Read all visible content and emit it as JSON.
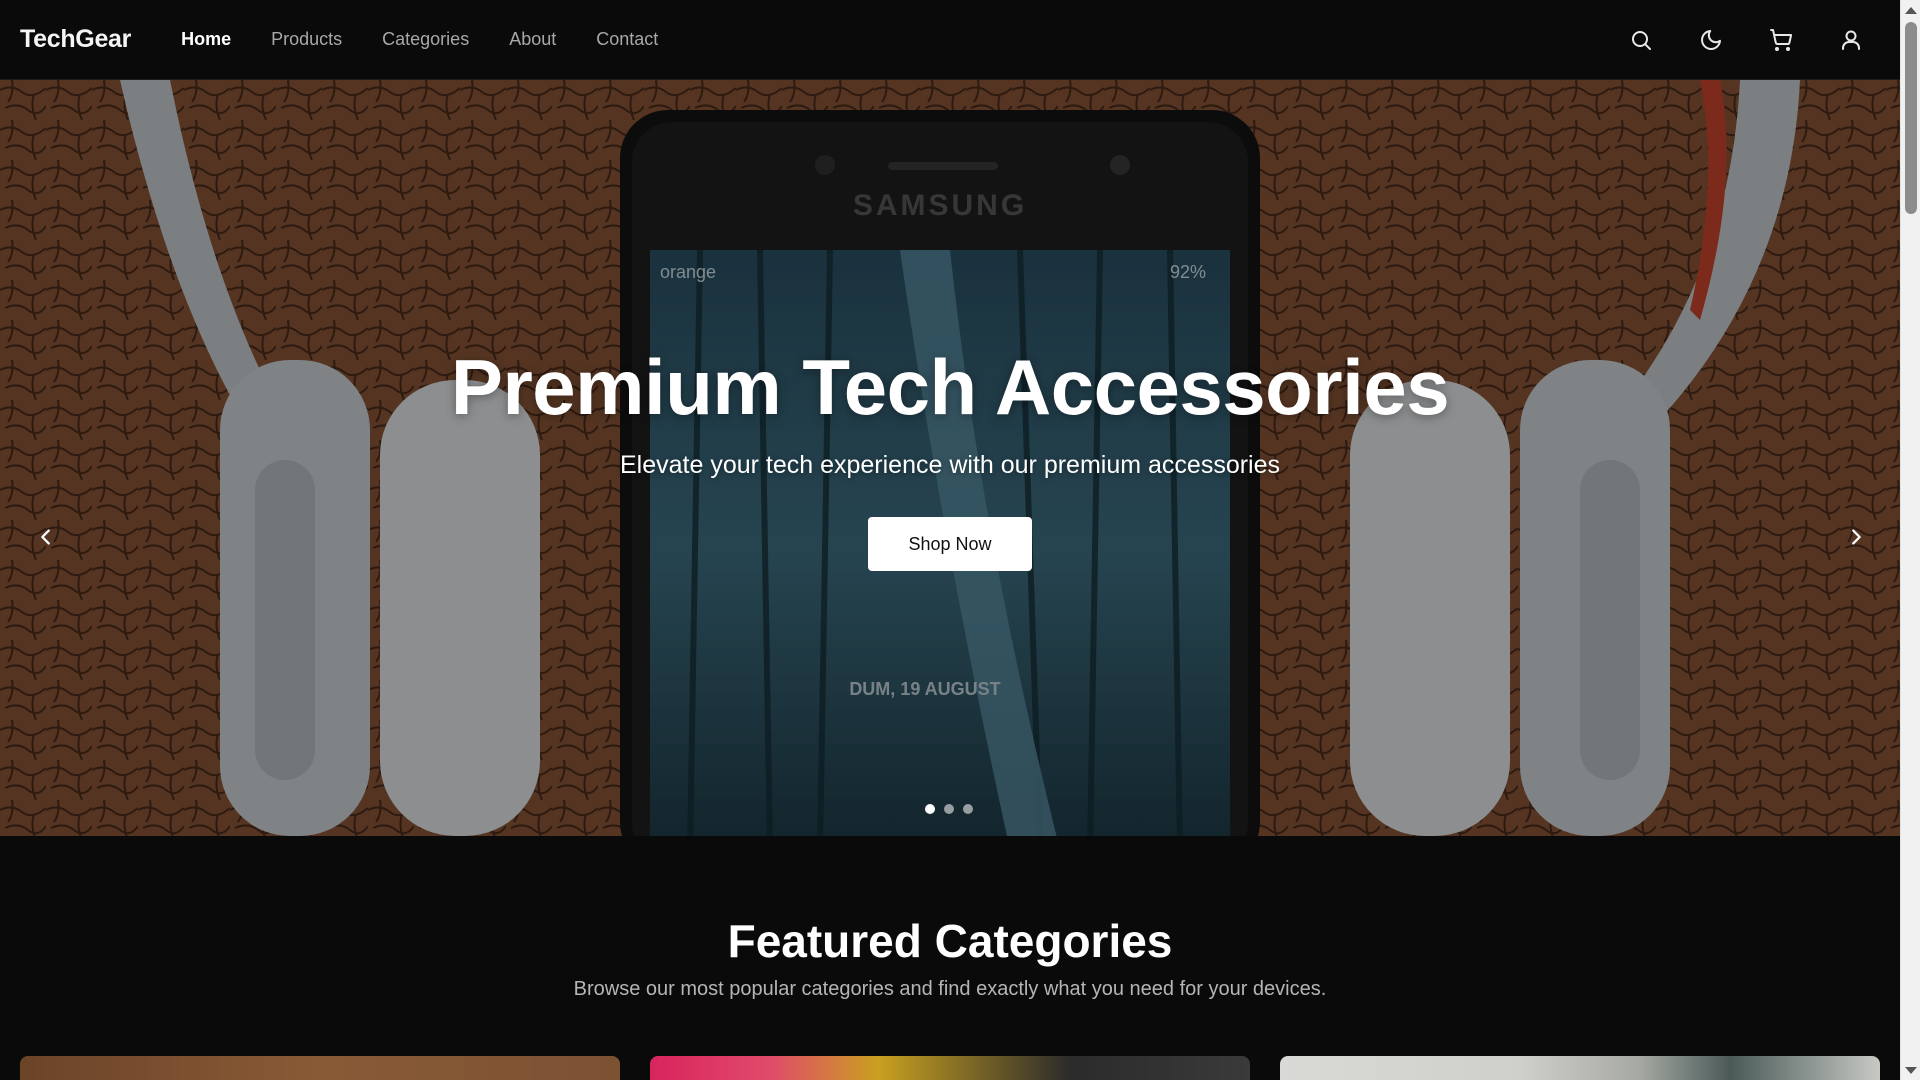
{
  "header": {
    "logo": "TechGear",
    "nav": [
      {
        "label": "Home",
        "active": true
      },
      {
        "label": "Products",
        "active": false
      },
      {
        "label": "Categories",
        "active": false
      },
      {
        "label": "About",
        "active": false
      },
      {
        "label": "Contact",
        "active": false
      }
    ],
    "icons": [
      "search-icon",
      "moon-icon",
      "cart-icon",
      "user-icon"
    ]
  },
  "hero": {
    "title": "Premium Tech Accessories",
    "subtitle": "Elevate your tech experience with our premium accessories",
    "cta": "Shop Now",
    "slides_total": 3,
    "active_slide": 1,
    "image_text": {
      "brand": "SAMSUNG",
      "carrier": "orange",
      "status": "92%",
      "date": "DUM, 19 AUGUST"
    }
  },
  "featured": {
    "title": "Featured Categories",
    "subtitle": "Browse our most popular categories and find exactly what you need for your devices."
  },
  "colors": {
    "background": "#0a0a0a",
    "accent": "#ffffff",
    "muted_text": "#b5b5b5"
  }
}
